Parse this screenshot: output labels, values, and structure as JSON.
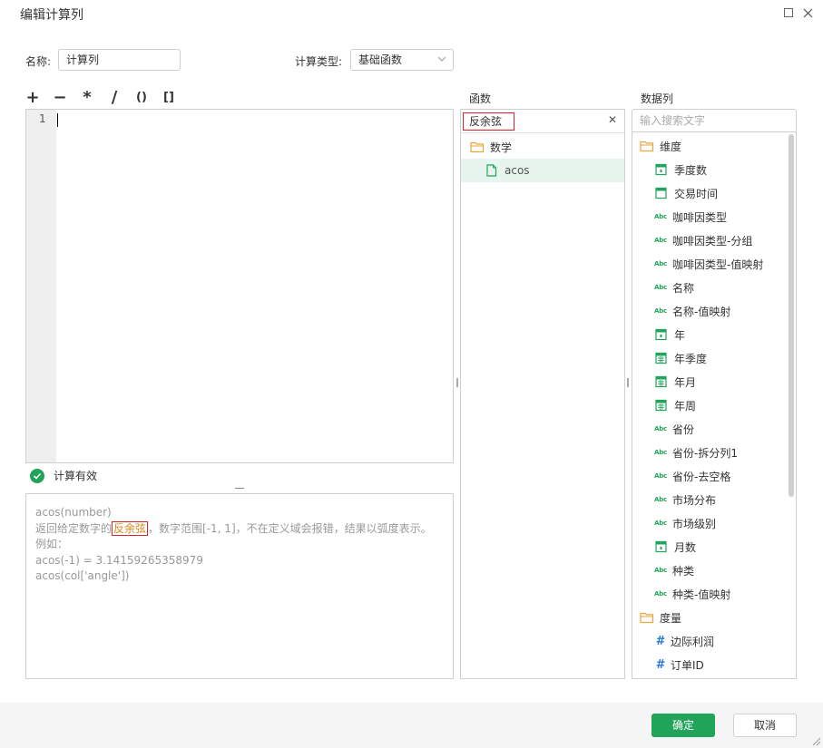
{
  "window": {
    "title": "编辑计算列"
  },
  "form": {
    "name_label": "名称:",
    "name_value": "计算列",
    "type_label": "计算类型:",
    "type_value": "基础函数"
  },
  "operators": [
    "+",
    "−",
    "*",
    "/",
    "()",
    "[]"
  ],
  "editor": {
    "line_number": "1",
    "status_text": "计算有效"
  },
  "description": {
    "signature": "acos(number)",
    "line2_before": "返回给定数字的",
    "line2_highlight": "反余弦",
    "line2_after": "，数字范围[-1, 1]，不在定义域会报错，结果以弧度表示。",
    "example_label": "例如：",
    "example1": "acos(-1) = 3.14159265358979",
    "example2": "acos(col['angle'])"
  },
  "functions": {
    "header": "函数",
    "search_value": "反余弦",
    "tree": [
      {
        "label": "数学",
        "kind": "folder"
      },
      {
        "label": "acos",
        "kind": "file",
        "selected": true
      }
    ]
  },
  "columns": {
    "header": "数据列",
    "search_placeholder": "输入搜索文字",
    "items": [
      {
        "label": "维度",
        "icon": "folder-icon"
      },
      {
        "label": "季度数",
        "icon": "date-icon"
      },
      {
        "label": "交易时间",
        "icon": "datetime-icon"
      },
      {
        "label": "咖啡因类型",
        "icon": "abc-icon"
      },
      {
        "label": "咖啡因类型-分组",
        "icon": "abc-icon"
      },
      {
        "label": "咖啡因类型-值映射",
        "icon": "abc-icon"
      },
      {
        "label": "名称",
        "icon": "abc-icon"
      },
      {
        "label": "名称-值映射",
        "icon": "abc-icon"
      },
      {
        "label": "年",
        "icon": "date-icon"
      },
      {
        "label": "年季度",
        "icon": "calendar-icon"
      },
      {
        "label": "年月",
        "icon": "calendar-icon"
      },
      {
        "label": "年周",
        "icon": "calendar-icon"
      },
      {
        "label": "省份",
        "icon": "abc-icon"
      },
      {
        "label": "省份-拆分列1",
        "icon": "abc-icon"
      },
      {
        "label": "省份-去空格",
        "icon": "abc-icon"
      },
      {
        "label": "市场分布",
        "icon": "abc-icon"
      },
      {
        "label": "市场级别",
        "icon": "abc-icon"
      },
      {
        "label": "月数",
        "icon": "date-icon"
      },
      {
        "label": "种类",
        "icon": "abc-icon"
      },
      {
        "label": "种类-值映射",
        "icon": "abc-icon"
      },
      {
        "label": "度量",
        "icon": "folder-icon"
      },
      {
        "label": "边际利润",
        "icon": "hash-icon"
      },
      {
        "label": "订单ID",
        "icon": "hash-icon"
      }
    ],
    "abc_glyph": "Abc",
    "hash_glyph": "#"
  },
  "footer": {
    "ok_label": "确定",
    "cancel_label": "取消"
  },
  "colors": {
    "accent": "#1fa45a",
    "highlight_border": "#d9232f",
    "folder": "#e8a53a",
    "hash": "#2a7ad5"
  }
}
